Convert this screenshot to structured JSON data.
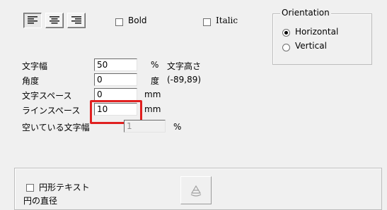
{
  "format_bar": {
    "align_buttons": [
      {
        "name": "align-left-icon",
        "pressed": true
      },
      {
        "name": "align-center-icon",
        "pressed": false
      },
      {
        "name": "align-right-icon",
        "pressed": false
      }
    ],
    "bold_label": "Bold",
    "italic_label": "Italic"
  },
  "orientation": {
    "title": "Orientation",
    "horizontal_label": "Horizontal",
    "vertical_label": "Vertical",
    "selected": "Horizontal"
  },
  "rows": {
    "char_width": {
      "label": "文字幅",
      "value": "50",
      "unit": "%",
      "extra": "文字高さ"
    },
    "angle": {
      "label": "角度",
      "value": "0",
      "unit": "度",
      "extra": "(-89,89)"
    },
    "char_space": {
      "label": "文字スペース",
      "value": "0",
      "unit": "mm"
    },
    "line_space": {
      "label": "ラインスペース",
      "value": "10",
      "unit": "mm"
    },
    "empty_width": {
      "label": "空いている文字幅",
      "value": "1",
      "unit": "%"
    }
  },
  "circle": {
    "circle_text_label": "円形テキスト",
    "diameter_label": "円の直径"
  },
  "colors": {
    "highlight": "#e02020",
    "background": "#f0f0f0"
  }
}
